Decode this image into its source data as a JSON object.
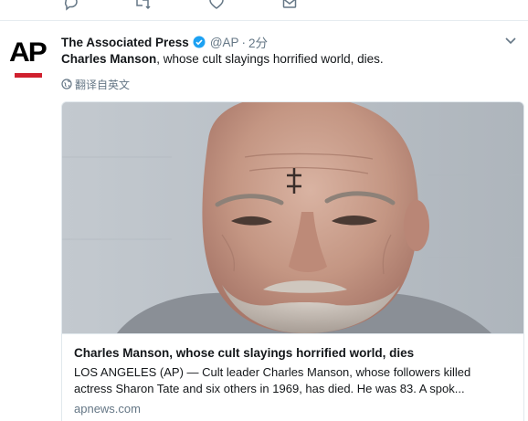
{
  "tweet": {
    "author_name": "The Associated Press",
    "handle": "@AP",
    "separator": "·",
    "time": "2分",
    "avatar_text": "AP",
    "text_bold": "Charles Manson",
    "text_rest": ", whose cult slayings horrified world, dies.",
    "translate_label": "翻译自英文"
  },
  "card": {
    "title": "Charles Manson, whose cult slayings horrified world, dies",
    "description": "LOS ANGELES (AP) — Cult leader Charles Manson, whose followers killed actress Sharon Tate and six others in 1969, has died. He was 83. A spok...",
    "domain": "apnews.com"
  },
  "icons": {
    "reply": "speech-bubble-icon",
    "retweet": "retweet-icon",
    "like": "heart-icon",
    "message": "envelope-icon",
    "verified": "verified-badge-icon",
    "caret": "chevron-down-icon",
    "globe": "globe-icon"
  },
  "colors": {
    "verified_blue": "#1da1f2",
    "ap_red": "#d0202e",
    "muted_text": "#657786",
    "border": "#e1e8ed"
  }
}
